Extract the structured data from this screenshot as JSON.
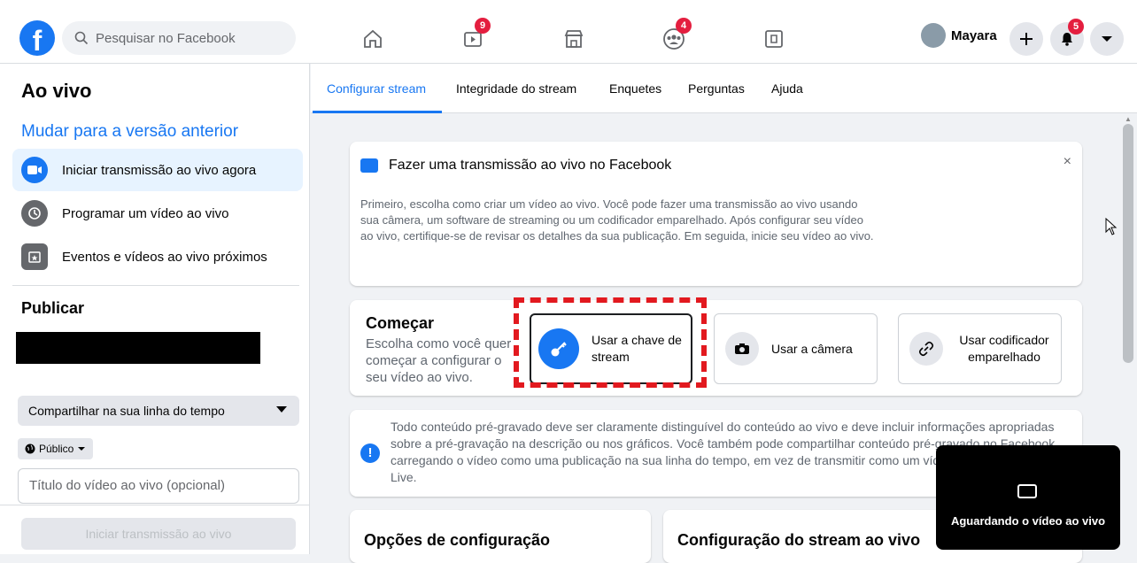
{
  "header": {
    "search_placeholder": "Pesquisar no Facebook",
    "profile_name": "Mayara",
    "badges": {
      "watch": "9",
      "groups": "4",
      "notifications": "5"
    },
    "logo_letter": "f"
  },
  "sidebar": {
    "title": "Ao vivo",
    "previous_version_link": "Mudar para a versão anterior",
    "items": [
      {
        "label": "Iniciar transmissão ao vivo agora",
        "icon": "live-camera-icon",
        "active": true
      },
      {
        "label": "Programar um vídeo ao vivo",
        "icon": "clock-icon",
        "active": false
      },
      {
        "label": "Eventos e vídeos ao vivo próximos",
        "icon": "calendar-star-icon",
        "active": false
      }
    ],
    "publish_title": "Publicar",
    "share_select": "Compartilhar na sua linha do tempo",
    "audience": "Público",
    "title_placeholder": "Título do vídeo ao vivo (opcional)",
    "start_button": "Iniciar transmissão ao vivo"
  },
  "tabs": [
    {
      "label": "Configurar stream",
      "active": true
    },
    {
      "label": "Integridade do stream",
      "active": false
    },
    {
      "label": "Enquetes",
      "active": false
    },
    {
      "label": "Perguntas",
      "active": false
    },
    {
      "label": "Ajuda",
      "active": false
    }
  ],
  "intro_card": {
    "title": "Fazer uma transmissão ao vivo no Facebook",
    "description": "Primeiro, escolha como criar um vídeo ao vivo. Você pode fazer uma transmissão ao vivo usando sua câmera, um software de streaming ou um codificador emparelhado. Após configurar seu vídeo ao vivo, certifique-se de revisar os detalhes da sua publicação. Em seguida, inicie seu vídeo ao vivo.",
    "close": "×"
  },
  "start_card": {
    "title": "Começar",
    "description": "Escolha como você quer começar a configurar o seu vídeo ao vivo.",
    "options": [
      {
        "label": "Usar a chave de stream",
        "icon": "key-icon",
        "selected": true
      },
      {
        "label": "Usar a câmera",
        "icon": "camera-icon",
        "selected": false
      },
      {
        "label": "Usar codificador emparelhado",
        "icon": "link-icon",
        "selected": false
      }
    ]
  },
  "notice": {
    "text": "Todo conteúdo pré-gravado deve ser claramente distinguível do conteúdo ao vivo e deve incluir informações apropriadas sobre a pré-gravação na descrição ou nos gráficos. Você também pode compartilhar conteúdo pré-gravado no Facebook carregando o vídeo como uma publicação na sua linha do tempo, em vez de transmitir como um vídeo ao vivo no Facebook Live.",
    "icon": "!"
  },
  "config_options_title": "Opções de configuração",
  "stream_config_title": "Configuração do stream ao vivo",
  "preview": {
    "text": "Aguardando o vídeo ao vivo"
  },
  "colors": {
    "accent": "#1877f2",
    "badge": "#e41e3f",
    "highlight": "#e2191f"
  }
}
